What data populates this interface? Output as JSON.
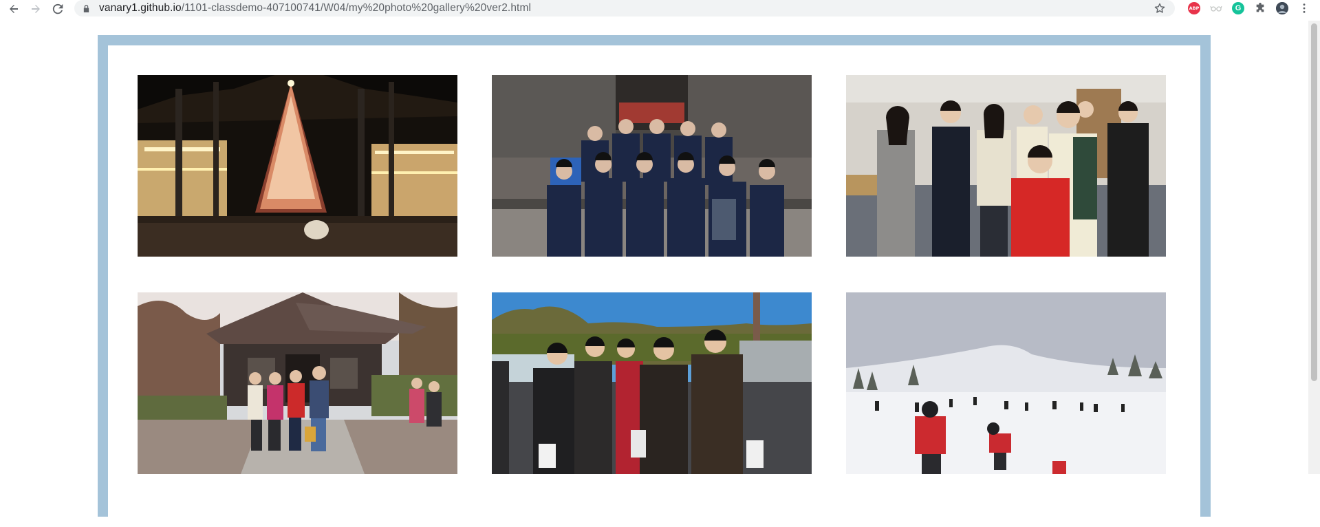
{
  "browser": {
    "url_host": "vanary1.github.io",
    "url_path": "/1101-classdemo-407100741/W04/my%20photo%20gallery%20ver2.html",
    "extensions": {
      "adblock_label": "ABP",
      "grammarly_label": "G"
    }
  },
  "gallery": {
    "frame_color": "#a4c3d9",
    "photos": [
      {
        "subject": "christmas-tree-night"
      },
      {
        "subject": "students-at-temple"
      },
      {
        "subject": "group-in-meeting-room"
      },
      {
        "subject": "japanese-house-group"
      },
      {
        "subject": "group-outdoors-mountain"
      },
      {
        "subject": "ski-slope"
      }
    ]
  }
}
